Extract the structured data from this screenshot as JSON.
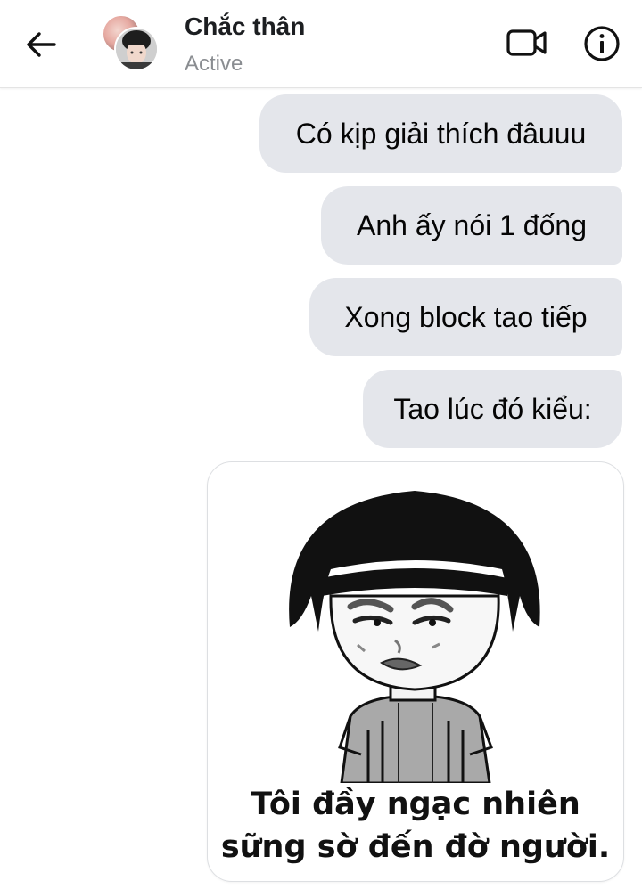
{
  "header": {
    "contact_name": "Chắc thân",
    "status": "Active",
    "icons": {
      "back": "arrow-left-icon",
      "video": "video-call-icon",
      "info": "info-icon"
    }
  },
  "messages": [
    {
      "text": "Có kịp giải thích đâuuu",
      "sender": "me"
    },
    {
      "text": "Anh ấy nói 1 đống",
      "sender": "me"
    },
    {
      "text": "Xong block tao tiếp",
      "sender": "me"
    },
    {
      "text": "Tao lúc đó kiểu:",
      "sender": "me"
    }
  ],
  "sticker": {
    "caption_line1": "Tôi đầy ngạc nhiên",
    "caption_line2": "sững sờ đến đờ người."
  },
  "colors": {
    "bubble_bg": "#e4e6eb",
    "text": "#050505",
    "status_gray": "#8a8d91"
  }
}
